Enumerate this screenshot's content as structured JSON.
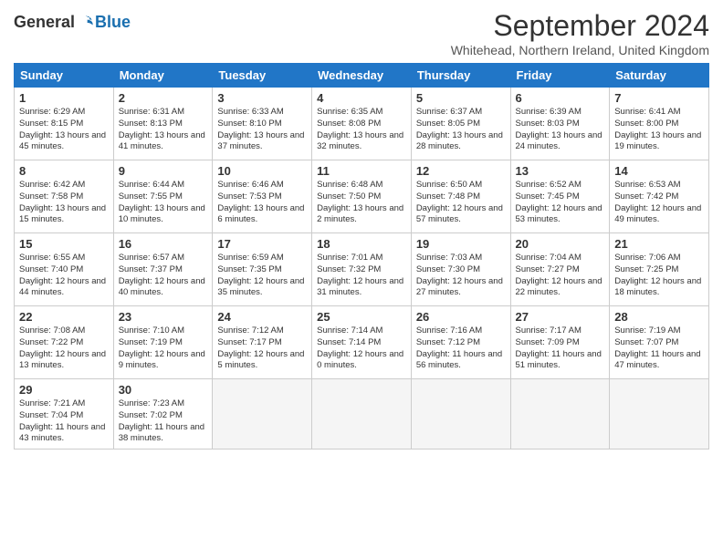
{
  "header": {
    "logo_general": "General",
    "logo_blue": "Blue",
    "month_title": "September 2024",
    "subtitle": "Whitehead, Northern Ireland, United Kingdom"
  },
  "days_of_week": [
    "Sunday",
    "Monday",
    "Tuesday",
    "Wednesday",
    "Thursday",
    "Friday",
    "Saturday"
  ],
  "weeks": [
    [
      {
        "day": "1",
        "sunrise": "6:29 AM",
        "sunset": "8:15 PM",
        "daylight": "13 hours and 45 minutes."
      },
      {
        "day": "2",
        "sunrise": "6:31 AM",
        "sunset": "8:13 PM",
        "daylight": "13 hours and 41 minutes."
      },
      {
        "day": "3",
        "sunrise": "6:33 AM",
        "sunset": "8:10 PM",
        "daylight": "13 hours and 37 minutes."
      },
      {
        "day": "4",
        "sunrise": "6:35 AM",
        "sunset": "8:08 PM",
        "daylight": "13 hours and 32 minutes."
      },
      {
        "day": "5",
        "sunrise": "6:37 AM",
        "sunset": "8:05 PM",
        "daylight": "13 hours and 28 minutes."
      },
      {
        "day": "6",
        "sunrise": "6:39 AM",
        "sunset": "8:03 PM",
        "daylight": "13 hours and 24 minutes."
      },
      {
        "day": "7",
        "sunrise": "6:41 AM",
        "sunset": "8:00 PM",
        "daylight": "13 hours and 19 minutes."
      }
    ],
    [
      {
        "day": "8",
        "sunrise": "6:42 AM",
        "sunset": "7:58 PM",
        "daylight": "13 hours and 15 minutes."
      },
      {
        "day": "9",
        "sunrise": "6:44 AM",
        "sunset": "7:55 PM",
        "daylight": "13 hours and 10 minutes."
      },
      {
        "day": "10",
        "sunrise": "6:46 AM",
        "sunset": "7:53 PM",
        "daylight": "13 hours and 6 minutes."
      },
      {
        "day": "11",
        "sunrise": "6:48 AM",
        "sunset": "7:50 PM",
        "daylight": "13 hours and 2 minutes."
      },
      {
        "day": "12",
        "sunrise": "6:50 AM",
        "sunset": "7:48 PM",
        "daylight": "12 hours and 57 minutes."
      },
      {
        "day": "13",
        "sunrise": "6:52 AM",
        "sunset": "7:45 PM",
        "daylight": "12 hours and 53 minutes."
      },
      {
        "day": "14",
        "sunrise": "6:53 AM",
        "sunset": "7:42 PM",
        "daylight": "12 hours and 49 minutes."
      }
    ],
    [
      {
        "day": "15",
        "sunrise": "6:55 AM",
        "sunset": "7:40 PM",
        "daylight": "12 hours and 44 minutes."
      },
      {
        "day": "16",
        "sunrise": "6:57 AM",
        "sunset": "7:37 PM",
        "daylight": "12 hours and 40 minutes."
      },
      {
        "day": "17",
        "sunrise": "6:59 AM",
        "sunset": "7:35 PM",
        "daylight": "12 hours and 35 minutes."
      },
      {
        "day": "18",
        "sunrise": "7:01 AM",
        "sunset": "7:32 PM",
        "daylight": "12 hours and 31 minutes."
      },
      {
        "day": "19",
        "sunrise": "7:03 AM",
        "sunset": "7:30 PM",
        "daylight": "12 hours and 27 minutes."
      },
      {
        "day": "20",
        "sunrise": "7:04 AM",
        "sunset": "7:27 PM",
        "daylight": "12 hours and 22 minutes."
      },
      {
        "day": "21",
        "sunrise": "7:06 AM",
        "sunset": "7:25 PM",
        "daylight": "12 hours and 18 minutes."
      }
    ],
    [
      {
        "day": "22",
        "sunrise": "7:08 AM",
        "sunset": "7:22 PM",
        "daylight": "12 hours and 13 minutes."
      },
      {
        "day": "23",
        "sunrise": "7:10 AM",
        "sunset": "7:19 PM",
        "daylight": "12 hours and 9 minutes."
      },
      {
        "day": "24",
        "sunrise": "7:12 AM",
        "sunset": "7:17 PM",
        "daylight": "12 hours and 5 minutes."
      },
      {
        "day": "25",
        "sunrise": "7:14 AM",
        "sunset": "7:14 PM",
        "daylight": "12 hours and 0 minutes."
      },
      {
        "day": "26",
        "sunrise": "7:16 AM",
        "sunset": "7:12 PM",
        "daylight": "11 hours and 56 minutes."
      },
      {
        "day": "27",
        "sunrise": "7:17 AM",
        "sunset": "7:09 PM",
        "daylight": "11 hours and 51 minutes."
      },
      {
        "day": "28",
        "sunrise": "7:19 AM",
        "sunset": "7:07 PM",
        "daylight": "11 hours and 47 minutes."
      }
    ],
    [
      {
        "day": "29",
        "sunrise": "7:21 AM",
        "sunset": "7:04 PM",
        "daylight": "11 hours and 43 minutes."
      },
      {
        "day": "30",
        "sunrise": "7:23 AM",
        "sunset": "7:02 PM",
        "daylight": "11 hours and 38 minutes."
      },
      null,
      null,
      null,
      null,
      null
    ]
  ]
}
